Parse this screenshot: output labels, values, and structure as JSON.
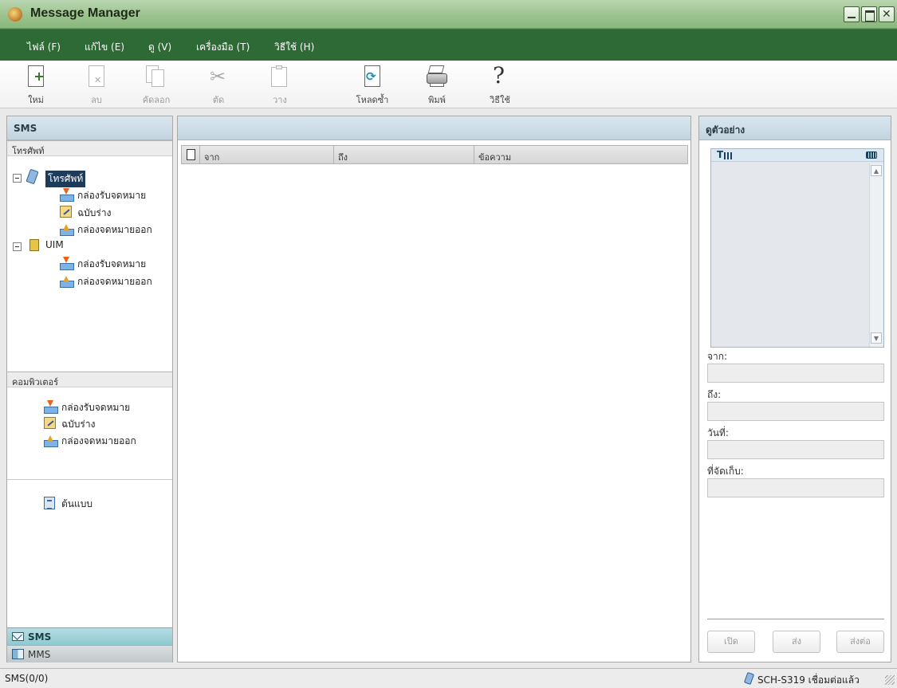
{
  "window": {
    "title": "Message Manager",
    "controls": [
      "minimize",
      "maximize",
      "close"
    ]
  },
  "menu": [
    {
      "label": "ไฟล์ (F)"
    },
    {
      "label": "แก้ไข (E)"
    },
    {
      "label": "ดู (V)"
    },
    {
      "label": "เครื่องมือ (T)"
    },
    {
      "label": "วิธีใช้ (H)"
    }
  ],
  "toolbar": {
    "new": "ใหม่",
    "delete": "ลบ",
    "copy": "คัดลอก",
    "cut": "ตัด",
    "paste": "วาง",
    "reload": "โหลดซ้ำ",
    "print": "พิมพ์",
    "help": "วิธีใช้"
  },
  "left_panel": {
    "title": "SMS",
    "phone_section": "โทรศัพท์",
    "phone_node": "โทรศัพท์",
    "phone_items": [
      "กล่องรับจดหมาย",
      "ฉบับร่าง",
      "กล่องจดหมายออก"
    ],
    "uim_node": "UIM",
    "uim_items": [
      "กล่องรับจดหมาย",
      "กล่องจดหมายออก"
    ],
    "computer_section": "คอมพิวเตอร์",
    "computer_items": [
      "กล่องรับจดหมาย",
      "ฉบับร่าง",
      "กล่องจดหมายออก"
    ],
    "template": "ต้นแบบ",
    "nav_sms": "SMS",
    "nav_mms": "MMS"
  },
  "message_table": {
    "columns": [
      "จาก",
      "ถึง",
      "ข้อความ"
    ],
    "rows": []
  },
  "preview": {
    "title": "ดูตัวอย่าง",
    "from_label": "จาก:",
    "to_label": "ถึง:",
    "date_label": "วันที่:",
    "storage_label": "ที่จัดเก็บ:",
    "open_button": "เปิด",
    "send_button": "ส่ง",
    "forward_button": "ส่งต่อ"
  },
  "status": {
    "left": "SMS(0/0)",
    "right": "SCH-S319 เชื่อมต่อแล้ว"
  }
}
